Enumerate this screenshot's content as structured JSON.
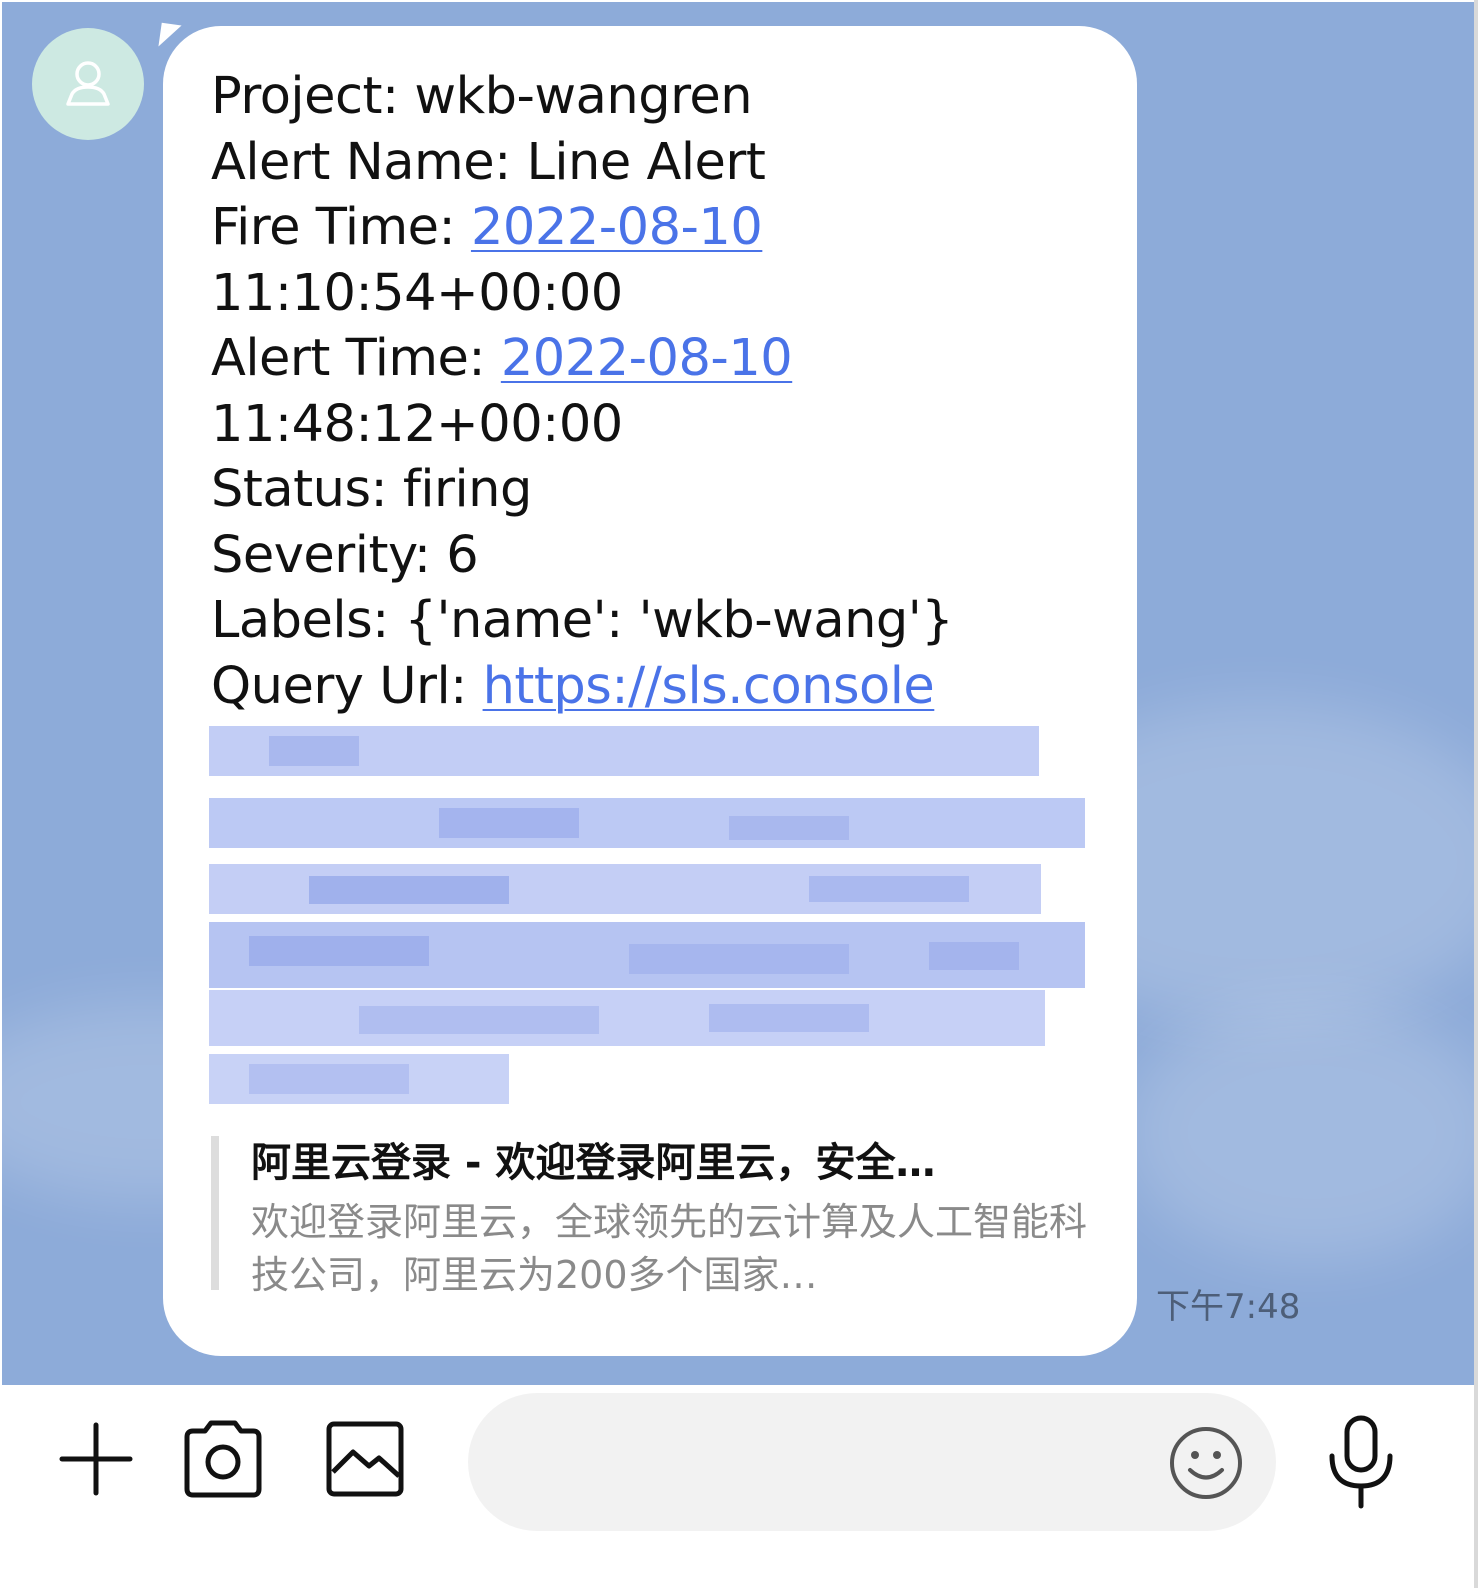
{
  "chat": {
    "background_color": "#8dabd9",
    "contact_avatar_icon": "person-outline-icon"
  },
  "message": {
    "project": "Project: wkb-wangren",
    "alert_name": "Alert Name: Line Alert",
    "fire_time_label": "Fire Time: ",
    "fire_time_date": "2022-08-10",
    "fire_time_time": "11:10:54+00:00",
    "alert_time_label": "Alert Time: ",
    "alert_time_date": "2022-08-10",
    "alert_time_time": "11:48:12+00:00",
    "status": "Status: firing",
    "severity": "Severity: 6",
    "labels": "Labels: {'name': 'wkb-wang'}",
    "query_url_label": "Query Url: ",
    "query_url_link": "https://sls.console",
    "link_color": "#4a73e8"
  },
  "link_preview": {
    "title": "阿里云登录 - 欢迎登录阿里云，安全…",
    "description": "欢迎登录阿里云，全球领先的云计算及人工智能科技公司，阿里云为200多个国家…"
  },
  "timestamp": "下午7:48",
  "input_bar": {
    "placeholder": "",
    "icons": [
      "plus-icon",
      "camera-icon",
      "image-icon",
      "emoji-icon",
      "microphone-icon"
    ]
  }
}
